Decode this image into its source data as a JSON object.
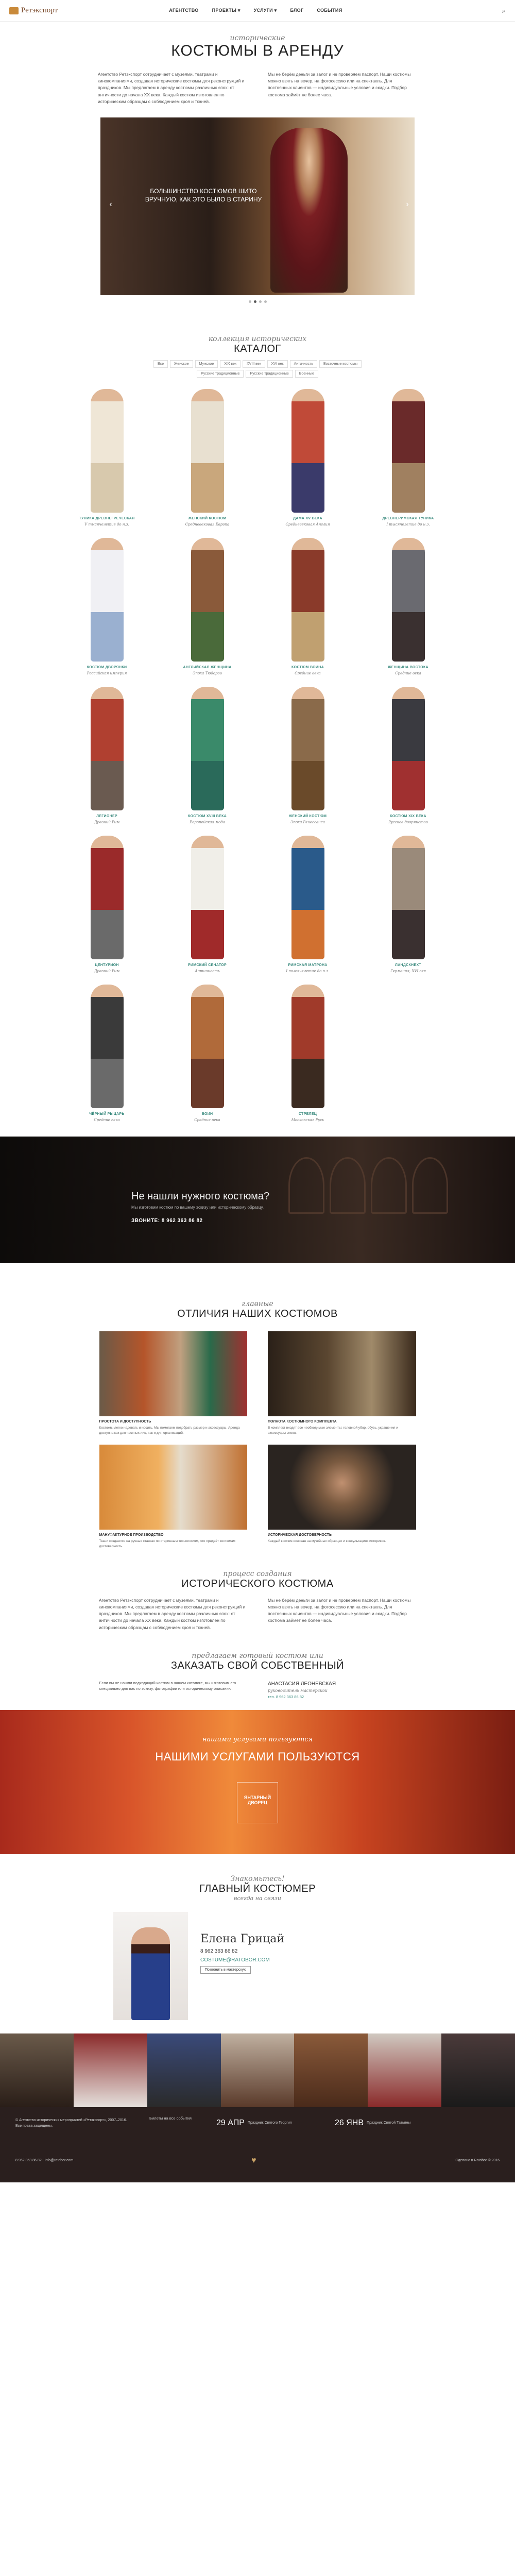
{
  "header": {
    "logo": "Ретэкспорт",
    "nav": [
      "АГЕНТСТВО",
      "ПРОЕКТЫ ▾",
      "УСЛУГИ ▾",
      "БЛОГ",
      "СОБЫТИЯ"
    ]
  },
  "hero": {
    "script": "исторические",
    "title": "КОСТЮМЫ В АРЕНДУ",
    "col1": "Агентство Ретэкспорт сотрудничает с музеями, театрами и кинокомпаниями, создавая исторические костюмы для реконструкций и праздников. Мы предлагаем в аренду костюмы различных эпох: от античности до начала XX века. Каждый костюм изготовлен по историческим образцам с соблюдением кроя и тканей.",
    "col2": "Мы не берём деньги за залог и не проверяем паспорт. Наши костюмы можно взять на вечер, на фотосессию или на спектакль. Для постоянных клиентов — индивидуальные условия и скидки. Подбор костюма займёт не более часа.",
    "slide_caption": "БОЛЬШИНСТВО КОСТЮМОВ ШИТО ВРУЧНУЮ, КАК ЭТО БЫЛО В СТАРИНУ"
  },
  "catalog": {
    "script": "коллекция исторических",
    "title": "КАТАЛОГ",
    "filters": [
      "Все",
      "Женское",
      "Мужское",
      "XIX век",
      "XVIII век",
      "XVI век",
      "Античность",
      "Восточные костюмы",
      "Русские традиционные",
      "Русские традиционные",
      "Военные"
    ],
    "items": [
      {
        "t": "ТУНИКА ДРЕВНЕГРЕЧЕСКАЯ",
        "s": "V тысячелетие до н.э."
      },
      {
        "t": "ЖЕНСКИЙ КОСТЮМ",
        "s": "Средневековая Европа"
      },
      {
        "t": "ДАМА XV ВЕКА",
        "s": "Средневековая Англия"
      },
      {
        "t": "ДРЕВНЕРИМСКАЯ ТУНИКА",
        "s": "I тысячелетие до н.э."
      },
      {
        "t": "КОСТЮМ ДВОРЯНКИ",
        "s": "Российская империя"
      },
      {
        "t": "АНГЛИЙСКАЯ ЖЕНЩИНА",
        "s": "Эпоха Тюдоров"
      },
      {
        "t": "КОСТЮМ ВОИНА",
        "s": "Средние века"
      },
      {
        "t": "ЖЕНЩИНА ВОСТОКА",
        "s": "Средние века"
      },
      {
        "t": "ЛЕГИОНЕР",
        "s": "Древний Рим"
      },
      {
        "t": "КОСТЮМ XVIII ВЕКА",
        "s": "Европейская мода"
      },
      {
        "t": "ЖЕНСКИЙ КОСТЮМ",
        "s": "Эпоха Ренессанса"
      },
      {
        "t": "КОСТЮМ XIX ВЕКА",
        "s": "Русское дворянство"
      },
      {
        "t": "ЦЕНТУРИОН",
        "s": "Древний Рим"
      },
      {
        "t": "РИМСКИЙ СЕНАТОР",
        "s": "Античность"
      },
      {
        "t": "РИМСКАЯ МАТРОНА",
        "s": "I тысячелетие до н.э."
      },
      {
        "t": "ЛАНДСКНЕХТ",
        "s": "Германия, XVI век"
      },
      {
        "t": "ЧЁРНЫЙ РЫЦАРЬ",
        "s": "Средние века"
      },
      {
        "t": "ВОИН",
        "s": "Средние века"
      },
      {
        "t": "СТРЕЛЕЦ",
        "s": "Московская Русь"
      }
    ]
  },
  "callout": {
    "heading": "Не нашли нужного костюма?",
    "text": "Мы изготовим костюм по вашему эскизу или историческому образцу.",
    "cta": "ЗВОНИТЕ: 8 962 363 86 82"
  },
  "diff": {
    "script": "главные",
    "title": "ОТЛИЧИЯ НАШИХ КОСТЮМОВ",
    "items": [
      {
        "t": "ПРОСТОТА И ДОСТУПНОСТЬ",
        "d": "Костюмы легко надевать и носить. Мы помогаем подобрать размер и аксессуары. Аренда доступна как для частных лиц, так и для организаций."
      },
      {
        "t": "ПОЛНОТА КОСТЮМНОГО КОМПЛЕКТА",
        "d": "В комплект входят все необходимые элементы: головной убор, обувь, украшения и аксессуары эпохи."
      },
      {
        "t": "МАНУФАКТУРНОЕ ПРОИЗВОДСТВО",
        "d": "Ткани создаются на ручных станках по старинным технологиям, что придаёт костюмам достоверность."
      },
      {
        "t": "ИСТОРИЧЕСКАЯ ДОСТОВЕРНОСТЬ",
        "d": "Каждый костюм основан на музейных образцах и консультациях историков."
      }
    ]
  },
  "process": {
    "script": "процесс создания",
    "title": "ИСТОРИЧЕСКОГО КОСТЮМА"
  },
  "order": {
    "script": "предлагаем готовый костюм или",
    "title": "ЗАКАЗАТЬ СВОЙ СОБСТВЕННЫЙ",
    "text": "Если вы не нашли подходящий костюм в нашем каталоге, мы изготовим его специально для вас по эскизу, фотографии или историческому описанию.",
    "name": "АНАСТАСИЯ ЛЕОНЕВСКАЯ",
    "role": "руководитель мастерской",
    "phone": "тел. 8 962 363 86 82"
  },
  "banner": {
    "script": "нашими услугами пользуются",
    "title": "НАШИМИ УСЛУГАМИ ПОЛЬЗУЮТСЯ",
    "logo": "ЯНТАРНЫЙ ДВОРЕЦ"
  },
  "contact": {
    "script": "Знакомьтесь!",
    "title": "ГЛАВНЫЙ КОСТЮМЕР",
    "sub": "всегда на связи",
    "name": "Елена Грицай",
    "phone": "8 962 363 86 82",
    "email": "COSTUME@RATOBOR.COM",
    "btn": "Позвонить в мастерскую"
  },
  "footer": {
    "addr": "© Агентство исторических мероприятий «Ретэкспорт», 2007–2016. Все права защищены.",
    "tel": "8 962 363 86 82 · info@ratobor.com",
    "event_label": "Билеты на все события",
    "ev1_date": "29 АПР",
    "ev1_text": "Праздник Святого Георгия",
    "ev2_date": "26 ЯНВ",
    "ev2_text": "Праздник Святой Татьяны",
    "copyright": "Сделано в Ratobor © 2016"
  }
}
